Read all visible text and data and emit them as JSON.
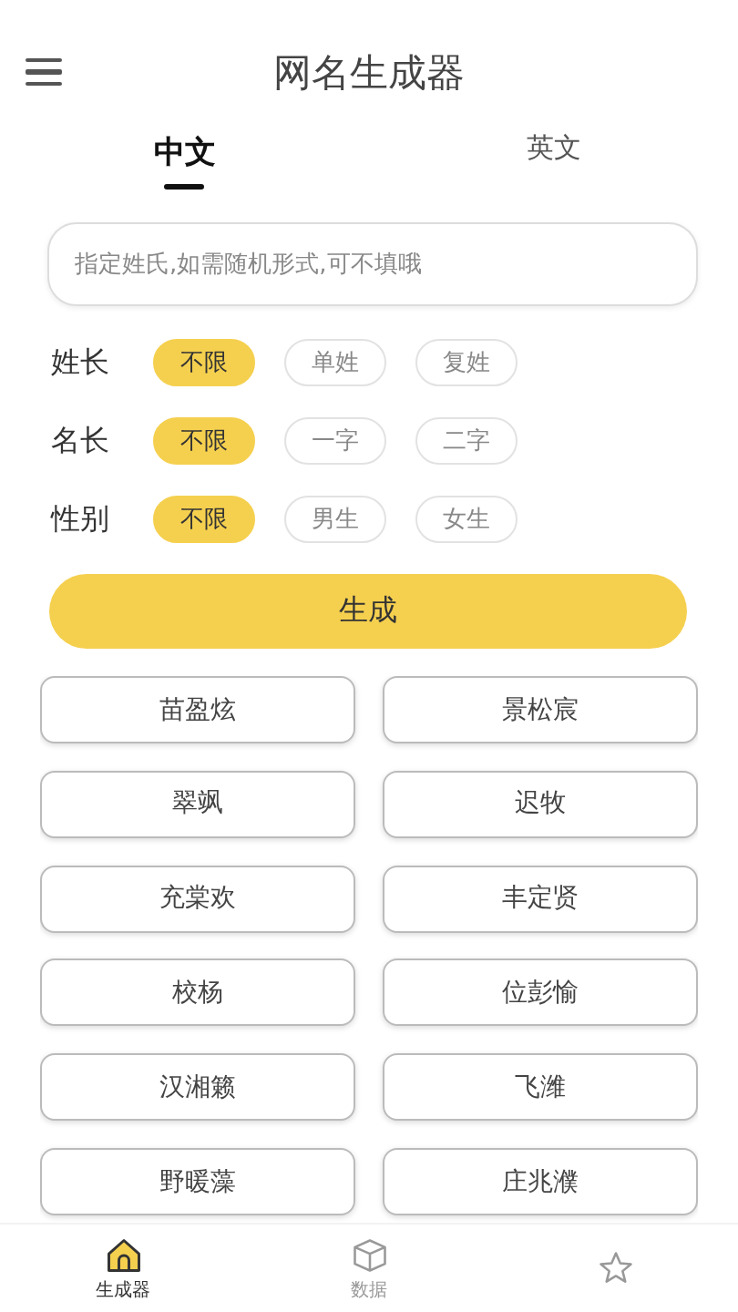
{
  "header": {
    "title": "网名生成器"
  },
  "tabs": [
    {
      "label": "中文",
      "selected": true
    },
    {
      "label": "英文",
      "selected": false
    }
  ],
  "surname_field": {
    "placeholder": "指定姓氏,如需随机形式,可不填哦"
  },
  "options": [
    {
      "label": "姓长",
      "choices": [
        {
          "label": "不限",
          "selected": true
        },
        {
          "label": "单姓",
          "selected": false
        },
        {
          "label": "复姓",
          "selected": false
        }
      ]
    },
    {
      "label": "名长",
      "choices": [
        {
          "label": "不限",
          "selected": true
        },
        {
          "label": "一字",
          "selected": false
        },
        {
          "label": "二字",
          "selected": false
        }
      ]
    },
    {
      "label": "性别",
      "choices": [
        {
          "label": "不限",
          "selected": true
        },
        {
          "label": "男生",
          "selected": false
        },
        {
          "label": "女生",
          "selected": false
        }
      ]
    }
  ],
  "generate_button": "生成",
  "names": [
    "苗盈炫",
    "景松宸",
    "翠飒",
    "迟牧",
    "充棠欢",
    "丰定贤",
    "校杨",
    "位彭愉",
    "汉湘籁",
    "飞潍",
    "野暖藻",
    "庄兆濮"
  ],
  "bottom_nav": [
    {
      "label": "生成器",
      "kind": "home",
      "selected": true
    },
    {
      "label": "数据",
      "kind": "box",
      "selected": false
    },
    {
      "kind": "star",
      "selected": false
    }
  ]
}
